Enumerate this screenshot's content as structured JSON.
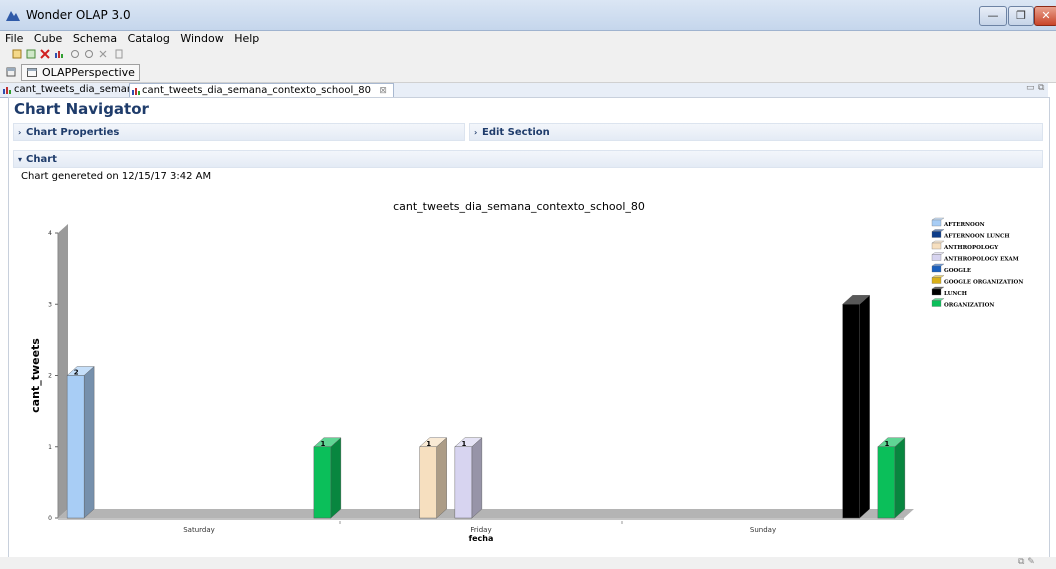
{
  "window": {
    "title": "Wonder OLAP 3.0",
    "min_label": "—",
    "max_label": "❐",
    "close_label": "✕"
  },
  "menu": {
    "items": [
      "File",
      "Cube",
      "Schema",
      "Catalog",
      "Window",
      "Help"
    ]
  },
  "perspective": {
    "label": "OLAPPerspective"
  },
  "tabs": [
    {
      "label": "cant_tweets_dia_semana"
    },
    {
      "label": "cant_tweets_dia_semana_contexto_school_80"
    }
  ],
  "navigator": {
    "title": "Chart Navigator",
    "chart_properties": "Chart Properties",
    "edit_section": "Edit Section",
    "chart_section": "Chart",
    "generated_text": "Chart genereted on 12/15/17 3:42 AM"
  },
  "colors": {
    "accent": "#1f3c6b",
    "AFTERNOON": "#a8cdf5",
    "AFTERNOON LUNCH": "#0d3d8a",
    "ANTHROPOLOGY": "#f6dfbf",
    "ANTHROPOLOGY EXAM": "#d7d4f0",
    "GOOGLE": "#1a5fbd",
    "GOOGLE ORGANIZATION": "#d9b018",
    "LUNCH": "#000000",
    "ORGANIZATION": "#0bbf5a"
  },
  "chart_data": {
    "type": "bar",
    "title": "cant_tweets_dia_semana_contexto_school_80",
    "xlabel": "fecha",
    "ylabel": "cant_tweets",
    "ylim": [
      0,
      4
    ],
    "yticks": [
      "0",
      "1",
      "2",
      "3",
      "4"
    ],
    "categories": [
      "Saturday",
      "Friday",
      "Sunday"
    ],
    "series": [
      {
        "name": "AFTERNOON",
        "values": [
          2,
          null,
          null
        ],
        "labels": [
          "2",
          "",
          ""
        ]
      },
      {
        "name": "AFTERNOON LUNCH",
        "values": [
          null,
          null,
          null
        ],
        "labels": [
          "",
          "",
          ""
        ]
      },
      {
        "name": "ANTHROPOLOGY",
        "values": [
          null,
          1,
          null
        ],
        "labels": [
          "",
          "1",
          ""
        ]
      },
      {
        "name": "ANTHROPOLOGY EXAM",
        "values": [
          null,
          1,
          null
        ],
        "labels": [
          "",
          "1",
          ""
        ]
      },
      {
        "name": "GOOGLE",
        "values": [
          null,
          null,
          null
        ],
        "labels": [
          "",
          "",
          ""
        ]
      },
      {
        "name": "GOOGLE ORGANIZATION",
        "values": [
          null,
          null,
          null
        ],
        "labels": [
          "",
          "",
          ""
        ]
      },
      {
        "name": "LUNCH",
        "values": [
          null,
          null,
          3
        ],
        "labels": [
          "",
          "",
          ""
        ]
      },
      {
        "name": "ORGANIZATION",
        "values": [
          1,
          null,
          1
        ],
        "labels": [
          "1",
          "",
          "1"
        ]
      }
    ],
    "legend": "top-right",
    "grid": false
  }
}
